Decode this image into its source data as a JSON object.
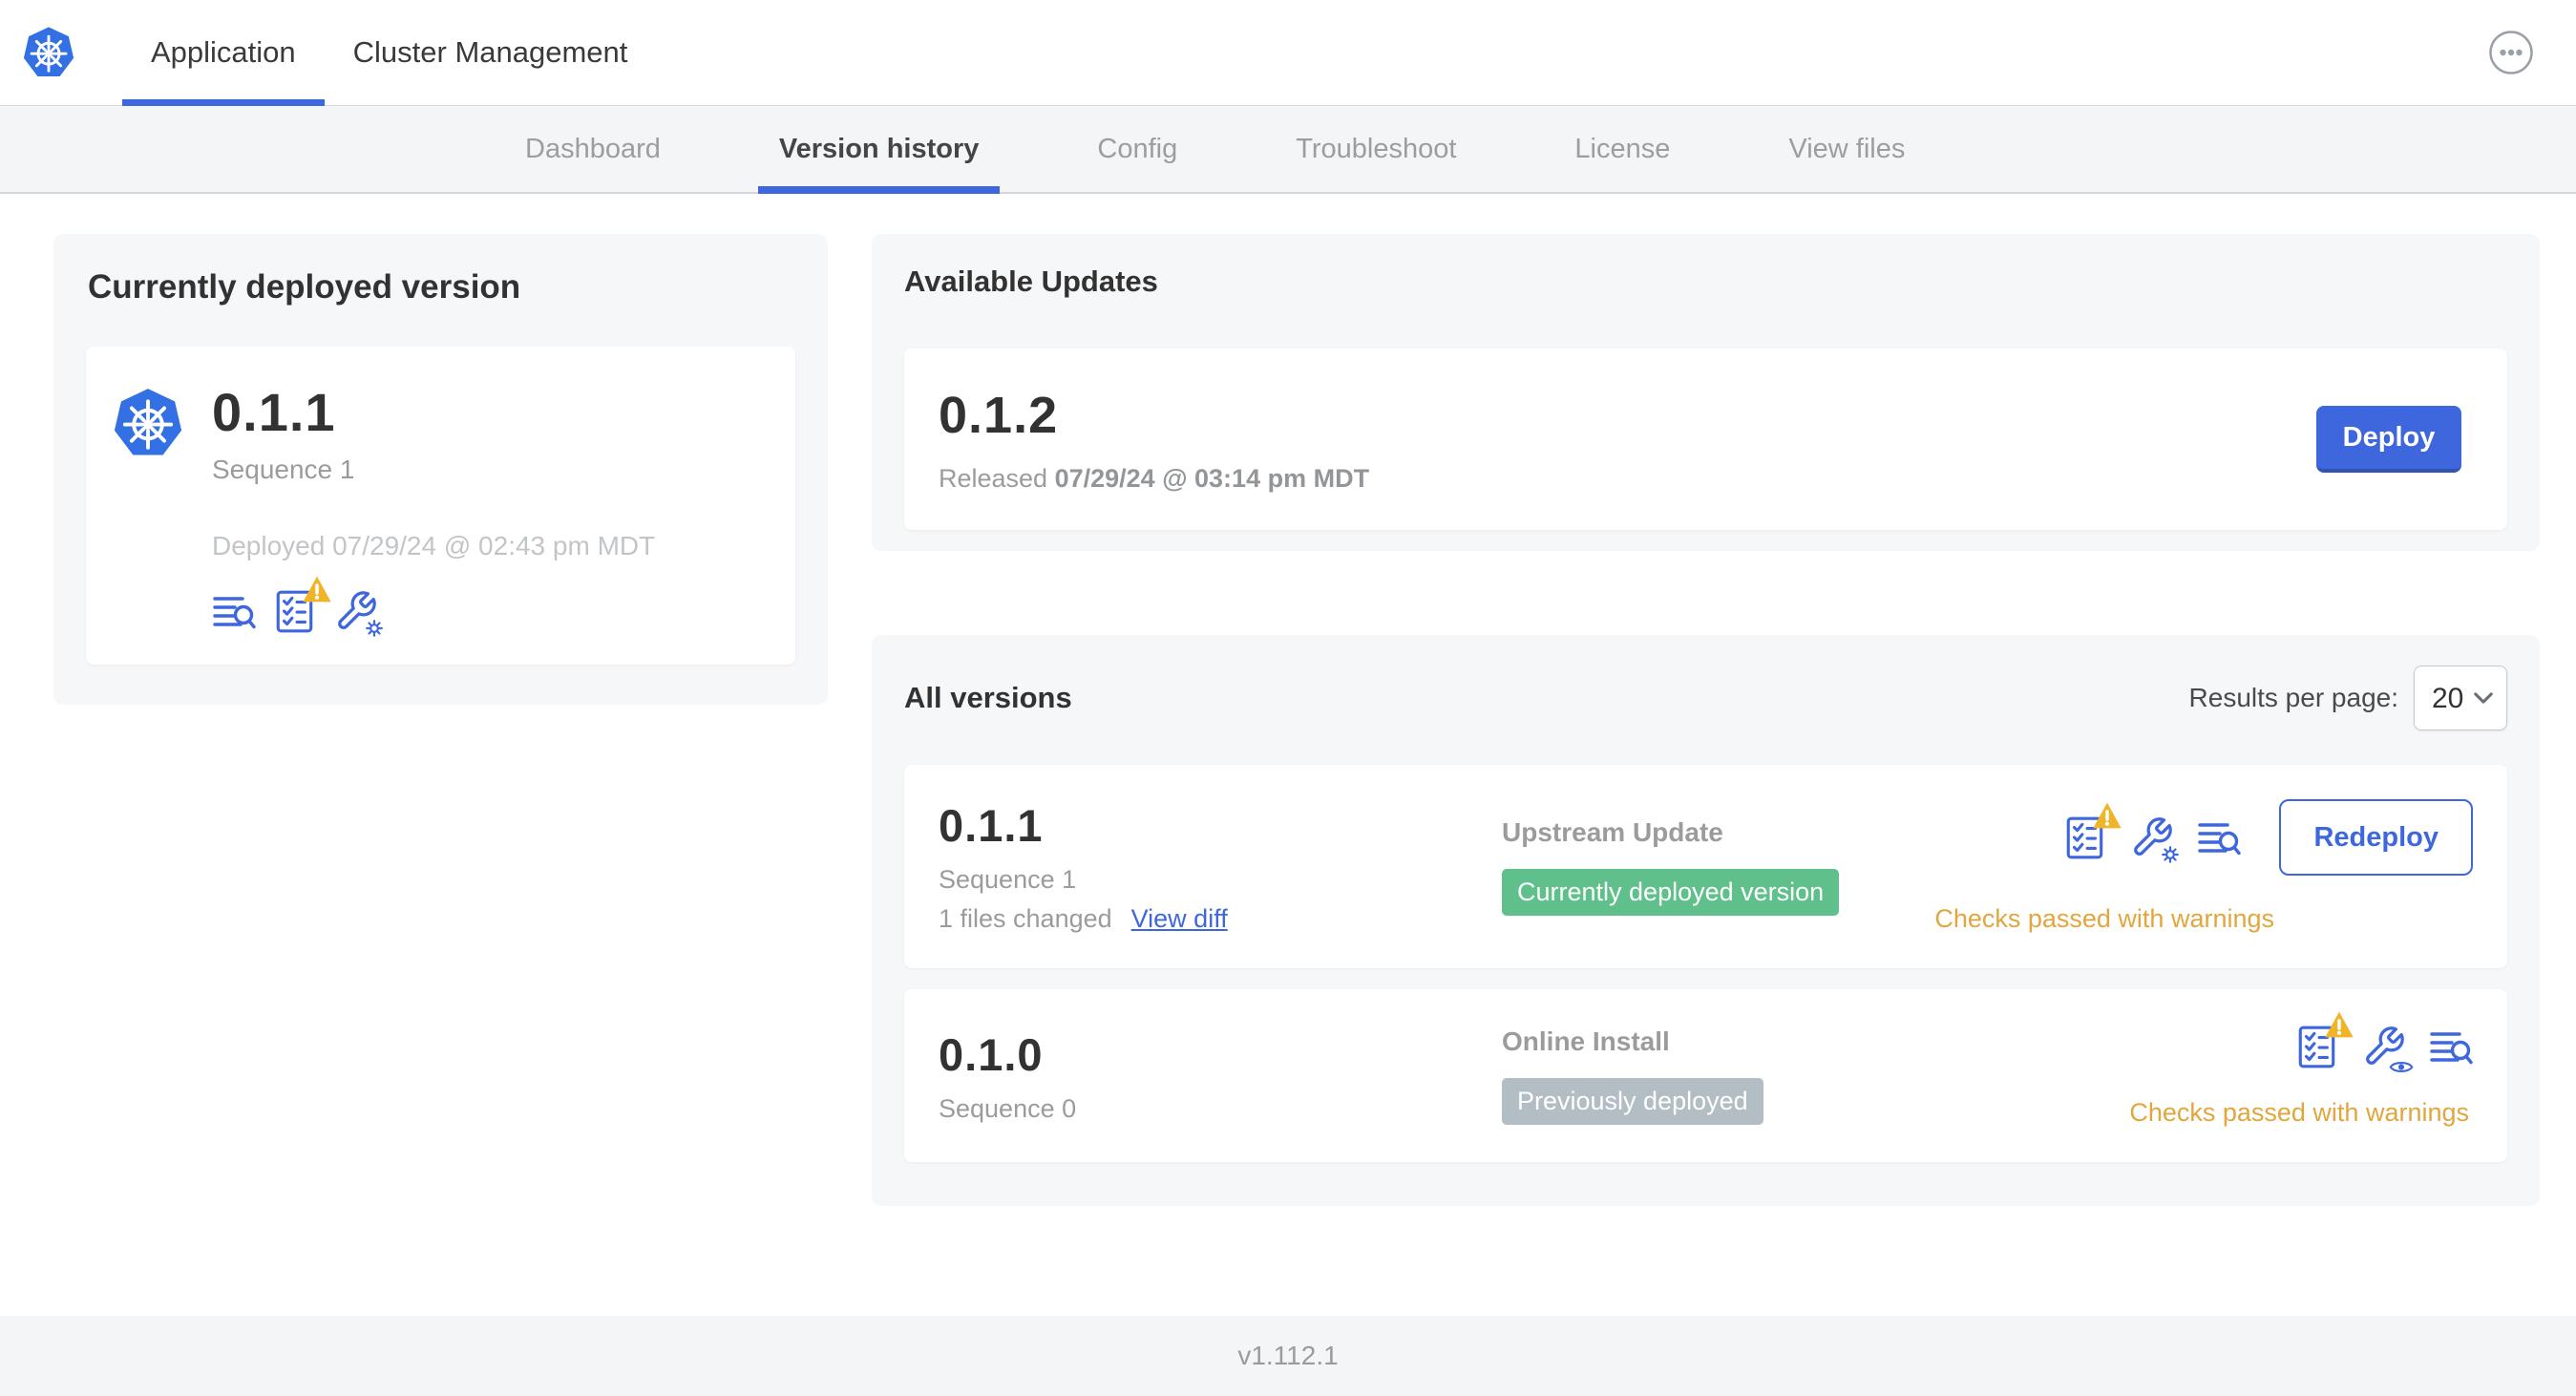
{
  "header": {
    "tabs": [
      {
        "label": "Application"
      },
      {
        "label": "Cluster Management"
      }
    ],
    "menu_icon": "ellipsis-menu-icon"
  },
  "subnav": {
    "tabs": [
      "Dashboard",
      "Version history",
      "Config",
      "Troubleshoot",
      "License",
      "View files"
    ],
    "active_tab": "Version history"
  },
  "current_version": {
    "title": "Currently deployed version",
    "version": "0.1.1",
    "sequence": "Sequence 1",
    "deployed_at": "Deployed 07/29/24 @ 02:43 pm MDT",
    "icons": [
      "logs-icon",
      "preflight-checks-warning-icon",
      "edit-config-icon"
    ]
  },
  "available_updates": {
    "title": "Available Updates",
    "update": {
      "version": "0.1.2",
      "released_label": "Released",
      "released_at": "07/29/24 @ 03:14 pm MDT",
      "deploy_label": "Deploy"
    }
  },
  "all_versions": {
    "title": "All versions",
    "results_per_page_label": "Results per page:",
    "results_per_page": "20",
    "rows": [
      {
        "version": "0.1.1",
        "sequence": "Sequence 1",
        "files_changed": "1 files changed",
        "view_diff": "View diff",
        "source": "Upstream Update",
        "badge": "Currently deployed version",
        "badge_color": "#5fc08c",
        "icons": [
          "preflight-checks-warning-icon",
          "edit-config-icon",
          "logs-icon"
        ],
        "status": "Checks passed with warnings",
        "action": "Redeploy"
      },
      {
        "version": "0.1.0",
        "sequence": "Sequence 0",
        "source": "Online Install",
        "badge": "Previously deployed",
        "badge_color": "#b2bdc4",
        "icons": [
          "preflight-checks-warning-icon",
          "view-config-icon",
          "logs-icon"
        ],
        "status": "Checks passed with warnings"
      }
    ]
  },
  "footer": {
    "app_version": "v1.112.1"
  },
  "colors": {
    "accent_blue": "#3e66dd",
    "kubernetes_blue": "#3370e4",
    "success_green": "#5fc08c",
    "neutral_badge_gray": "#b2bdc4",
    "warning_amber": "#e2a63d",
    "warning_triangle": "#f0b429",
    "card_background": "#f5f7f9"
  }
}
